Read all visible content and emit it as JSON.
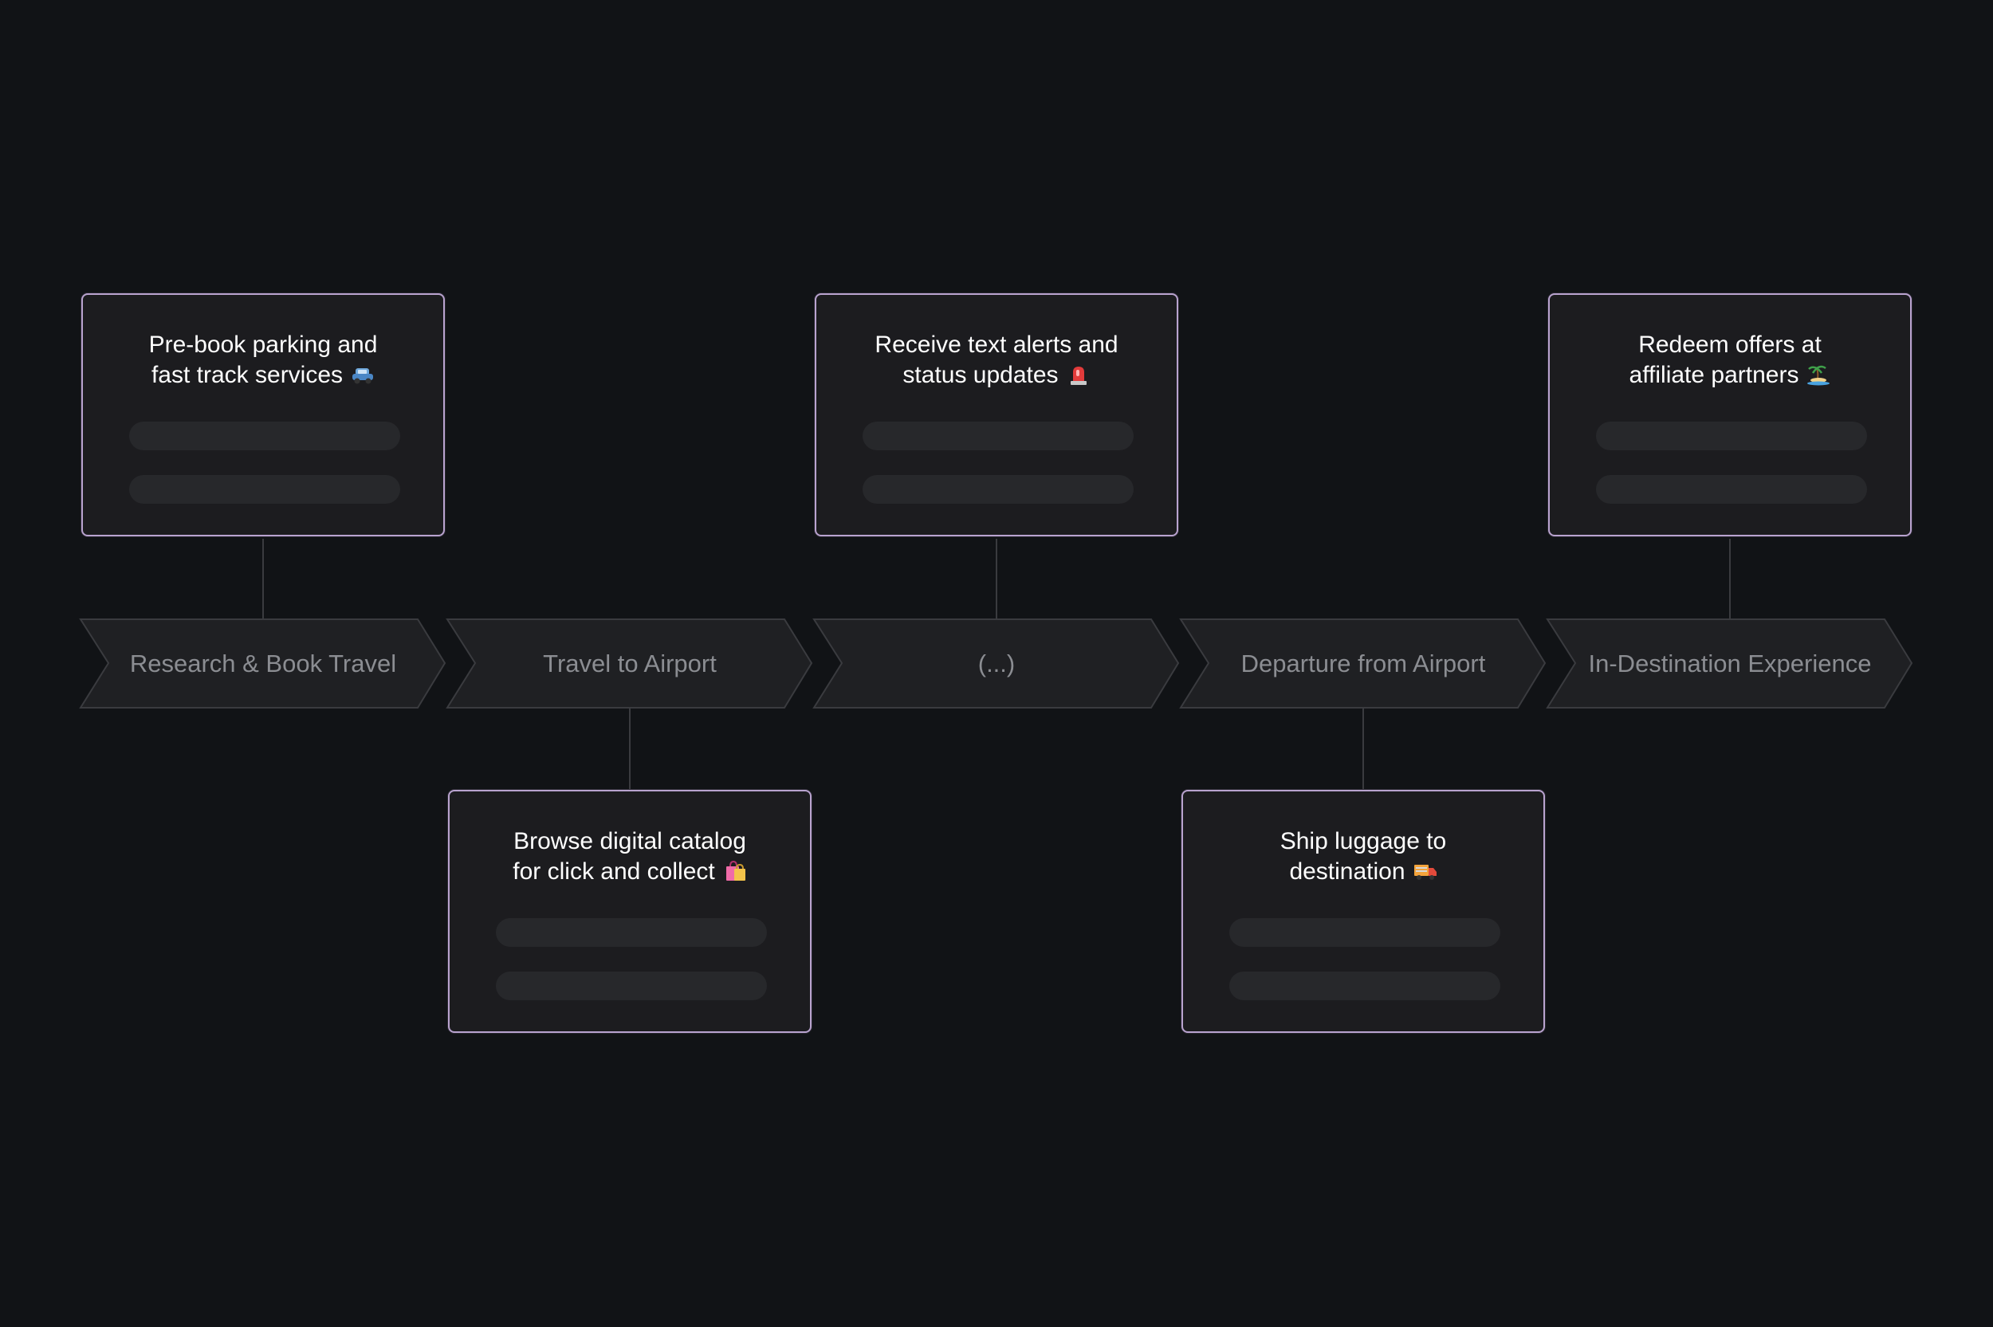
{
  "stages": [
    {
      "label": "Research & Book Travel"
    },
    {
      "label": "Travel to Airport"
    },
    {
      "label": "(...)"
    },
    {
      "label": "Departure from Airport"
    },
    {
      "label": "In-Destination Experience"
    }
  ],
  "cards": [
    {
      "line1": "Pre-book parking and",
      "line2": "fast track services",
      "icon": "car-icon"
    },
    {
      "line1": "Browse digital catalog",
      "line2": "for click and collect",
      "icon": "shopping-bags-icon"
    },
    {
      "line1": "Receive text alerts and",
      "line2": "status updates",
      "icon": "siren-icon"
    },
    {
      "line1": "Ship luggage to",
      "line2": "destination",
      "icon": "delivery-truck-icon"
    },
    {
      "line1": "Redeem offers at",
      "line2": "affiliate partners",
      "icon": "island-icon"
    }
  ],
  "colors": {
    "background": "#111316",
    "card_border": "#b9a3cf",
    "card_fill": "#1c1c1f",
    "stage_fill": "#1f2023",
    "stage_text": "#8b8d92",
    "connector": "#3a3b3f"
  }
}
